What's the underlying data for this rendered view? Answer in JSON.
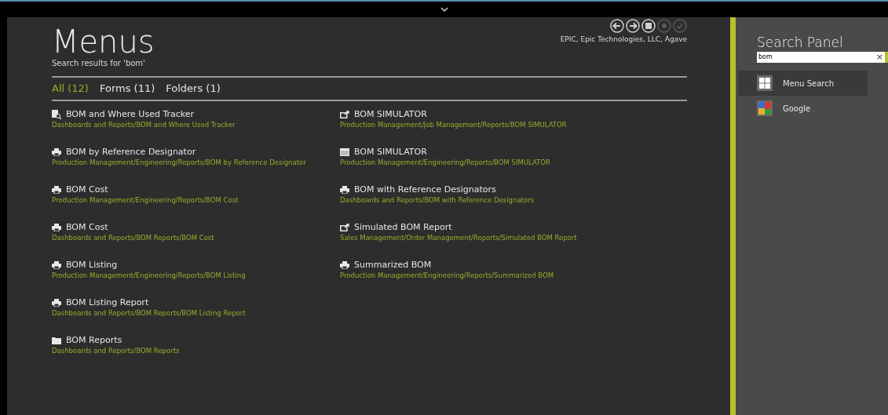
{
  "header": {
    "title": "Menus",
    "subtitle": "Search results for 'bom'",
    "company": "EPIC, Epic Technologies, LLC, Agave"
  },
  "nav_buttons": [
    {
      "kind": "back",
      "disabled": false
    },
    {
      "kind": "forward",
      "disabled": false
    },
    {
      "kind": "home",
      "disabled": false
    },
    {
      "kind": "dot",
      "disabled": true
    },
    {
      "kind": "check",
      "disabled": true
    }
  ],
  "tabs": [
    {
      "label": "All (12)",
      "selected": true
    },
    {
      "label": "Forms (11)",
      "selected": false
    },
    {
      "label": "Folders (1)",
      "selected": false
    }
  ],
  "columns": [
    [
      {
        "kind": "tracker",
        "title": "BOM and Where Used Tracker",
        "path": "Dashboards and Reports/BOM and Where Used Tracker"
      },
      {
        "kind": "report",
        "title": "BOM by Reference Designator",
        "path": "Production Management/Engineering/Reports/BOM by Reference Designator"
      },
      {
        "kind": "report",
        "title": "BOM Cost",
        "path": "Production Management/Engineering/Reports/BOM Cost"
      },
      {
        "kind": "report",
        "title": "BOM Cost",
        "path": "Dashboards and Reports/BOM Reports/BOM Cost"
      },
      {
        "kind": "report",
        "title": "BOM Listing",
        "path": "Production Management/Engineering/Reports/BOM Listing"
      },
      {
        "kind": "report",
        "title": "BOM Listing Report",
        "path": "Dashboards and Reports/BOM Reports/BOM Listing Report"
      },
      {
        "kind": "folder",
        "title": "BOM Reports",
        "path": "Dashboards and Reports/BOM Reports"
      }
    ],
    [
      {
        "kind": "launch",
        "title": "BOM SIMULATOR",
        "path": "Production Management/Job Management/Reports/BOM SIMULATOR"
      },
      {
        "kind": "form",
        "title": "BOM SIMULATOR",
        "path": "Production Management/Engineering/Reports/BOM SIMULATOR"
      },
      {
        "kind": "report",
        "title": "BOM with Reference Designators",
        "path": "Dashboards and Reports/BOM with Reference Designators"
      },
      {
        "kind": "launch",
        "title": "Simulated BOM Report",
        "path": "Sales Management/Order Management/Reports/Simulated BOM Report"
      },
      {
        "kind": "report",
        "title": "Summarized BOM",
        "path": "Production Management/Engineering/Reports/Summarized BOM"
      }
    ]
  ],
  "search_panel": {
    "title": "Search Panel",
    "query": "bom",
    "clear": "×",
    "providers": [
      {
        "kind": "menu",
        "label": "Menu Search",
        "selected": true
      },
      {
        "kind": "google",
        "label": "Google",
        "selected": false
      }
    ]
  }
}
